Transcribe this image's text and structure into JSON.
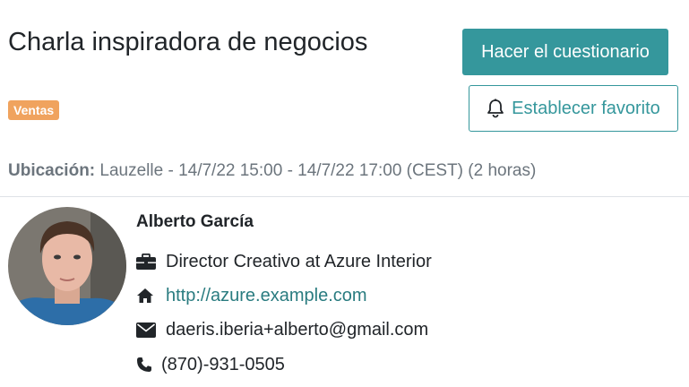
{
  "event": {
    "title": "Charla inspiradora de negocios",
    "tag": "Ventas",
    "location_label": "Ubicación:",
    "location_value": "Lauzelle - 14/7/22 15:00 - 14/7/22 17:00 (CEST) (2 horas)"
  },
  "actions": {
    "quiz_label": "Hacer el cuestionario",
    "favorite_label": "Establecer favorito",
    "favorite_icon": "bell-icon"
  },
  "speaker": {
    "name": "Alberto García",
    "job": "Director Creativo at Azure Interior",
    "website": "http://azure.example.com",
    "email": "daeris.iberia+alberto@gmail.com",
    "phone": "(870)-931-0505",
    "icons": [
      "briefcase-icon",
      "home-icon",
      "envelope-icon",
      "phone-icon"
    ]
  },
  "colors": {
    "accent": "#35979c",
    "tag": "#f0a35e",
    "link": "#2a7c80"
  }
}
